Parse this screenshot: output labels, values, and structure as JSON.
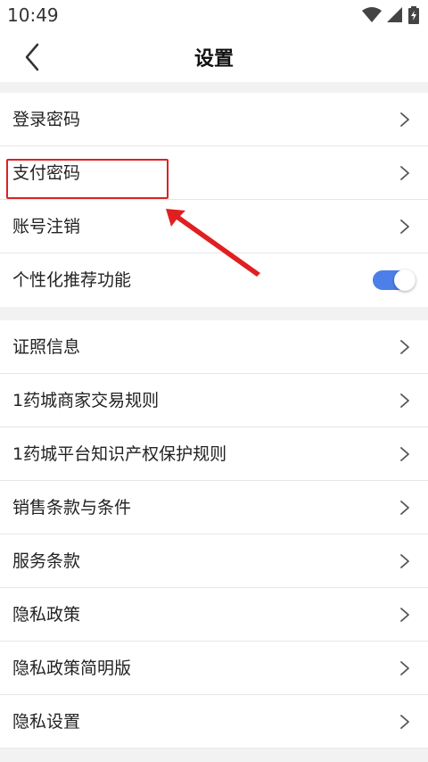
{
  "status_bar": {
    "time": "10:49"
  },
  "header": {
    "title": "设置",
    "back_icon": "chevron-left-icon"
  },
  "settings_group_1": [
    {
      "label": "登录密码",
      "type": "link"
    },
    {
      "label": "支付密码",
      "type": "link"
    },
    {
      "label": "账号注销",
      "type": "link"
    },
    {
      "label": "个性化推荐功能",
      "type": "toggle",
      "enabled": true
    }
  ],
  "settings_group_2": [
    {
      "label": "证照信息"
    },
    {
      "label": "1药城商家交易规则"
    },
    {
      "label": "1药城平台知识产权保护规则"
    },
    {
      "label": "销售条款与条件"
    },
    {
      "label": "服务条款"
    },
    {
      "label": "隐私政策"
    },
    {
      "label": "隐私政策简明版"
    },
    {
      "label": "隐私设置"
    }
  ],
  "colors": {
    "toggle_on": "#4c80e8",
    "annotation": "#e02020",
    "background": "#f2f2f2"
  }
}
